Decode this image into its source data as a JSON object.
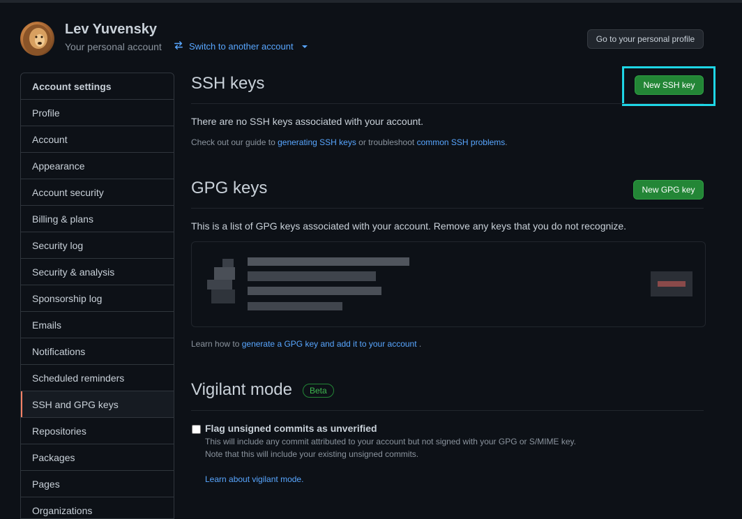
{
  "header": {
    "user_name": "Lev Yuvensky",
    "account_type": "Your personal account",
    "switch_account": "Switch to another account",
    "profile_button": "Go to your personal profile"
  },
  "sidebar": {
    "heading": "Account settings",
    "items": [
      {
        "label": "Profile"
      },
      {
        "label": "Account"
      },
      {
        "label": "Appearance"
      },
      {
        "label": "Account security"
      },
      {
        "label": "Billing & plans"
      },
      {
        "label": "Security log"
      },
      {
        "label": "Security & analysis"
      },
      {
        "label": "Sponsorship log"
      },
      {
        "label": "Emails"
      },
      {
        "label": "Notifications"
      },
      {
        "label": "Scheduled reminders"
      },
      {
        "label": "SSH and GPG keys",
        "selected": true
      },
      {
        "label": "Repositories"
      },
      {
        "label": "Packages"
      },
      {
        "label": "Pages"
      },
      {
        "label": "Organizations"
      }
    ]
  },
  "ssh": {
    "title": "SSH keys",
    "new_button": "New SSH key",
    "empty": "There are no SSH keys associated with your account.",
    "guide_prefix": "Check out our guide to",
    "guide_link": "generating SSH keys",
    "guide_middle": "or troubleshoot",
    "problems_link": "common SSH problems",
    "guide_suffix": "."
  },
  "gpg": {
    "title": "GPG keys",
    "new_button": "New GPG key",
    "description": "This is a list of GPG keys associated with your account. Remove any keys that you do not recognize.",
    "learn_prefix": "Learn how to",
    "learn_link": "generate a GPG key and add it to your account",
    "learn_suffix": "."
  },
  "vigilant": {
    "title": "Vigilant mode",
    "badge": "Beta",
    "checkbox_label": "Flag unsigned commits as unverified",
    "checked": false,
    "desc1": "This will include any commit attributed to your account but not signed with your GPG or S/MIME key.",
    "desc2": "Note that this will include your existing unsigned commits.",
    "learn_link": "Learn about vigilant mode."
  },
  "colors": {
    "background": "#0d1117",
    "link": "#58a6ff",
    "primary_button": "#238636",
    "selected_accent": "#f78166",
    "highlight": "#1ed6e6"
  }
}
